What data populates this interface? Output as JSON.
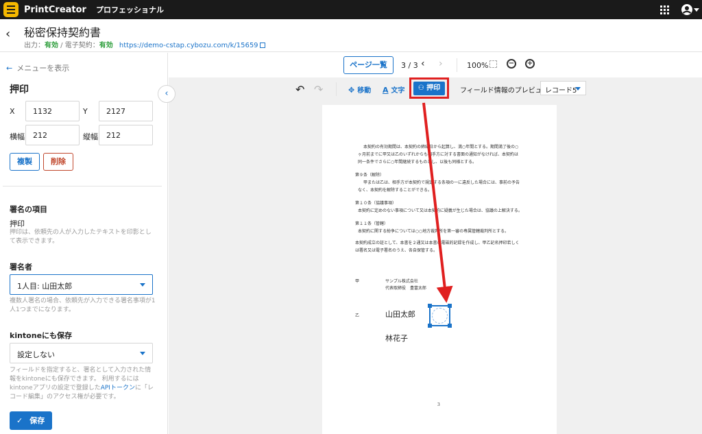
{
  "app": {
    "brand": "PrintCreator",
    "edition": "プロフェッショナル"
  },
  "header": {
    "title": "秘密保持契約書",
    "output_label": "出力：",
    "output_status": "有効",
    "separator": " / ",
    "esign_label": "電子契約：",
    "esign_status": "有効",
    "url": "https://demo-cstap.cybozu.com/k/15659"
  },
  "left_panel": {
    "menu_link": "メニューを表示",
    "title": "押印",
    "x_label": "X",
    "x_value": "1132",
    "y_label": "Y",
    "y_value": "2127",
    "width_label": "横幅",
    "width_value": "212",
    "height_label": "縦幅",
    "height_value": "212",
    "duplicate": "複製",
    "delete": "削除",
    "signature_item_title": "署名の項目",
    "signature_item_value": "押印",
    "signature_item_help": "押印は、依頼先の人が入力したテキストを印影として表示できます。",
    "signer_title": "署名者",
    "signer_value": "1人目: 山田太郎",
    "signer_help": "複数人署名の場合、依頼先が入力できる署名事項が1人1つまでになります。",
    "kintone_title": "kintoneにも保存",
    "kintone_value": "設定しない",
    "kintone_help_1": "フィールドを指定すると、署名として入力された情報をkintoneにも保存できます。",
    "kintone_help_2": "利用するにはkintoneアプリの設定で登録した",
    "kintone_help_api": "APIトークン",
    "kintone_help_3": "に「レコード編集」のアクセス権が必要です。",
    "save": "保存"
  },
  "toolbar": {
    "page_list": "ページ一覧",
    "page_indicator": "3 / 3",
    "zoom": "100%",
    "move": "移動",
    "text": "文字",
    "stamp": "押印",
    "preview_label": "フィールド情報のプレビュー",
    "record_value": "レコード5"
  },
  "document": {
    "lines": [
      "本契約の有効期間は、本契約の締結日から起算し、満○年間とする。期間満了後の○",
      "ヶ月前までに甲又は乙のいずれからも相手方に対する書面の通知がなければ、本契約は",
      "同一条件でさらに○年間継続するものとし、以後も同様とする。",
      "第９条（解除）",
      "甲または乙は、相手方が本契約で規定する条項の一に違反した場合には、事前の予告",
      "なく、本契約を解除することができる。",
      "第１０条（協議事項）",
      "本契約に定めのない事項について又は本契約に疑義が生じた場合は、協議の上解決する。",
      "第１１条（管轄）",
      "本契約に関する紛争については○○地方裁判所を第一審の専属管轄裁判所とする。",
      "本契約成立の証として、本書を２通又は本書の電磁的記録を作成し、甲乙記名押印若しく",
      "は署名又は電子署名のうえ、各自保管する。"
    ],
    "party_a_label": "甲",
    "party_a_company": "サンプル株式会社",
    "party_a_rep": "代表取締役　豊富太郎",
    "party_b_label": "乙",
    "signer_1": "山田太郎",
    "signer_2": "林花子",
    "page_number": "3"
  },
  "colors": {
    "accent": "#1a73c9",
    "danger": "#c0462b",
    "ok": "#2e9e3c",
    "highlight": "#e02020"
  }
}
